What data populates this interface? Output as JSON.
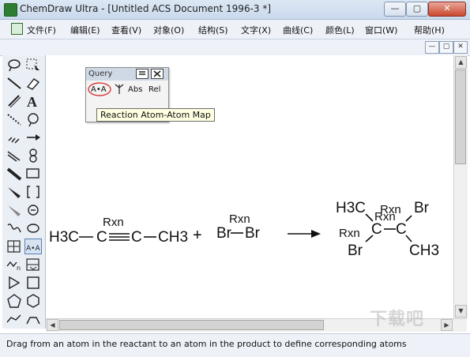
{
  "window": {
    "title": "ChemDraw Ultra - [Untitled ACS Document 1996-3 *]",
    "minimize_glyph": "—",
    "restore_glyph": "▢",
    "close_glyph": "✕",
    "icons": [
      "app-icon",
      "minimize-icon",
      "restore-icon",
      "close-icon"
    ]
  },
  "menubar": {
    "items": [
      "文件(F)",
      "编辑(E)",
      "查看(V)",
      "对象(O)",
      "结构(S)",
      "文字(X)",
      "曲线(C)",
      "颜色(L)",
      "窗口(W)",
      "帮助(H)"
    ],
    "doc_controls": [
      "—",
      "▢",
      "✕"
    ]
  },
  "query_panel": {
    "title": "Query",
    "tools": [
      "A•A",
      "Abs",
      "Rel"
    ],
    "icons": [
      "menu-icon",
      "close-icon",
      "atom-map-icon",
      "stereo-icon"
    ]
  },
  "tooltip": {
    "text": "Reaction Atom-Atom Map"
  },
  "reaction": {
    "reactant1": {
      "left": "H3C",
      "mid1": "C",
      "mid2": "C",
      "right": "CH3",
      "label": "Rxn"
    },
    "plus": "+",
    "reactant2": {
      "left": "Br",
      "right": "Br",
      "label": "Rxn"
    },
    "product": {
      "ch3_top": "H3C",
      "br_top": "Br",
      "c1": "C",
      "c2": "C",
      "br_bottom": "Br",
      "ch3_bottom": "CH3",
      "label_top1": "Rxn",
      "label_top2": "Rxn",
      "label_left": "Rxn"
    }
  },
  "palette": {
    "icons": [
      "lasso-icon",
      "select-icon",
      "bond-icon",
      "eraser-icon",
      "pen-icon",
      "text-icon",
      "dash-bond-icon",
      "ring-icon",
      "hash-bond-icon",
      "arrow-icon",
      "multi-bond-icon",
      "orbital-icon",
      "bold-bond-icon",
      "rectangle-icon",
      "wedge-bond-icon",
      "bracket-icon",
      "hashed-wedge-icon",
      "charge-icon",
      "wavy-bond-icon",
      "chain-icon",
      "table-icon",
      "atom-map-icon",
      "chain-n-icon",
      "template-icon",
      "triangle-icon",
      "square-icon",
      "pentagon-icon",
      "hexagon-icon",
      "cyclohexane-icon"
    ]
  },
  "statusbar": {
    "text": "Drag from an atom in the reactant to an atom in the product to define corresponding atoms"
  },
  "watermark": "下载吧",
  "colors": {
    "accent": "#d63a3a",
    "tooltip_bg": "#ffffe1",
    "chrome": "#eef2f8"
  }
}
